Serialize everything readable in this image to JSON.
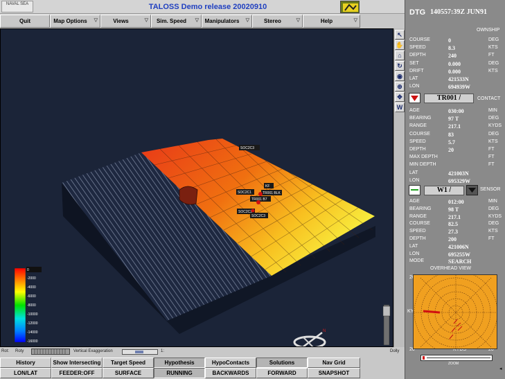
{
  "titlebar": {
    "title": "TALOSS Demo release 20020910",
    "logo_text": "NAVAL SEA"
  },
  "menubar": {
    "items": [
      "Quit",
      "Map Options",
      "Views",
      "Sim. Speed",
      "Manipulators",
      "Stereo",
      "Help"
    ]
  },
  "toolstrip": {
    "tools": [
      "pointer-icon",
      "hand-icon",
      "home-icon",
      "rotate-icon",
      "eye-icon",
      "crosshair-icon",
      "compass-icon",
      "w-icon"
    ],
    "w_label": "W"
  },
  "legend": {
    "ticks": [
      "0",
      "-2000",
      "-4000",
      "-6000",
      "-8000",
      "-10000",
      "-12000",
      "-14000",
      "-16000"
    ]
  },
  "scene": {
    "labels": [
      "SOC2C3",
      "TR001 BLK",
      "KF",
      "TR001 B7",
      "SOC2C1",
      "SOC2C2"
    ],
    "compass_dir": "N"
  },
  "status": {
    "rot_label": "Rot:",
    "roty_label": "Roty",
    "vert_label": "Vertical Exaggeration",
    "vert_value": "1:",
    "dolly_label": "Dolly"
  },
  "bottom_row1": [
    "History",
    "Show Intersecting",
    "Target Speed",
    "Hypothesis",
    "HypoContacts",
    "Solutions",
    "Nav Grid"
  ],
  "bottom_row2": [
    "LON/LAT",
    "FEEDER:OFF",
    "SURFACE",
    "RUNNING",
    "BACKWARDS",
    "FORWARD",
    "SNAPSHOT"
  ],
  "panel": {
    "dtg_label": "DTG",
    "dtg_value": "140557:39Z JUN91",
    "ownship_title": "OWNSHIP",
    "ownship": [
      {
        "k": "COURSE",
        "v": "0",
        "u": "DEG"
      },
      {
        "k": "SPEED",
        "v": "8.3",
        "u": "KTS"
      },
      {
        "k": "DEPTH",
        "v": "240",
        "u": "FT"
      },
      {
        "k": "SET",
        "v": "0.000",
        "u": "DEG"
      },
      {
        "k": "DRIFT",
        "v": "0.000",
        "u": "KTS"
      },
      {
        "k": "LAT",
        "v": "421533N",
        "u": ""
      },
      {
        "k": "LON",
        "v": "694939W",
        "u": ""
      }
    ],
    "contact_title": "CONTACT",
    "contact_id": "TR001",
    "contact_slash": "/",
    "contact": [
      {
        "k": "AGE",
        "v": "030:00",
        "u": "MIN"
      },
      {
        "k": "BEARING",
        "v": "97 T",
        "u": "DEG"
      },
      {
        "k": "RANGE",
        "v": "217.1",
        "u": "KYDS"
      },
      {
        "k": "COURSE",
        "v": "83",
        "u": "DEG"
      },
      {
        "k": "SPEED",
        "v": "5.7",
        "u": "KTS"
      },
      {
        "k": "DEPTH",
        "v": "20",
        "u": "FT"
      },
      {
        "k": "MAX DEPTH",
        "v": "",
        "u": "FT"
      },
      {
        "k": "MIN DEPTH",
        "v": "",
        "u": "FT"
      },
      {
        "k": "LAT",
        "v": "421003N",
        "u": ""
      },
      {
        "k": "LON",
        "v": "695329W",
        "u": ""
      }
    ],
    "sensor_title": "SENSOR",
    "sensor_id": "W1",
    "sensor_slash": "/",
    "sensor": [
      {
        "k": "AGE",
        "v": "012:00",
        "u": "MIN"
      },
      {
        "k": "BEARING",
        "v": "98 T",
        "u": "DEG"
      },
      {
        "k": "RANGE",
        "v": "217.1",
        "u": "KYDS"
      },
      {
        "k": "COURSE",
        "v": "82.5",
        "u": "DEG"
      },
      {
        "k": "SPEED",
        "v": "27.3",
        "u": "KTS"
      },
      {
        "k": "DEPTH",
        "v": "200",
        "u": "FT"
      },
      {
        "k": "LAT",
        "v": "421006N",
        "u": ""
      },
      {
        "k": "LON",
        "v": "695255W",
        "u": ""
      },
      {
        "k": "MODE",
        "v": "SEARCH",
        "u": ""
      }
    ],
    "overhead_title": "OVERHEAD VIEW",
    "overhead_top_left": "20",
    "overhead_bottom_left": "20",
    "overhead_bottom_right": "20",
    "overhead_kyds_left": "KYDS",
    "overhead_kyds_bottom": "KYDS",
    "zoom_label": "ZOOM"
  },
  "colors": {
    "contact_marker": "#cc1010",
    "sensor_marker": "#20a020"
  }
}
